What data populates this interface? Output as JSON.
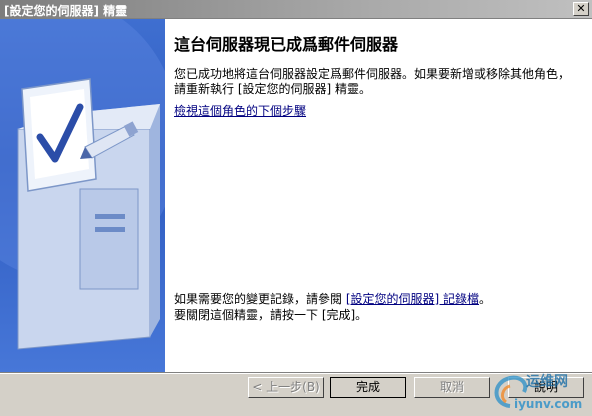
{
  "window": {
    "title": "[設定您的伺服器] 精靈",
    "close_symbol": "✕"
  },
  "main": {
    "heading": "這台伺服器現已成爲郵件伺服器",
    "description": "您已成功地將這台伺服器設定爲郵件伺服器。如果要新增或移除其他角色，請重新執行 [設定您的伺服器] 精靈。",
    "next_steps_link": "檢視這個角色的下個步驟",
    "log_prefix": "如果需要您的變更記錄，請參閱 ",
    "log_link": "[設定您的伺服器] 記錄檔",
    "log_suffix": "。",
    "finish_text": "要關閉這個精靈，請按一下 [完成]。"
  },
  "buttons": {
    "back": "< 上一步(B)",
    "finish": "完成",
    "cancel": "取消",
    "help": "說明"
  },
  "watermark": {
    "cn": "运维网",
    "url": "iyunv.com"
  }
}
